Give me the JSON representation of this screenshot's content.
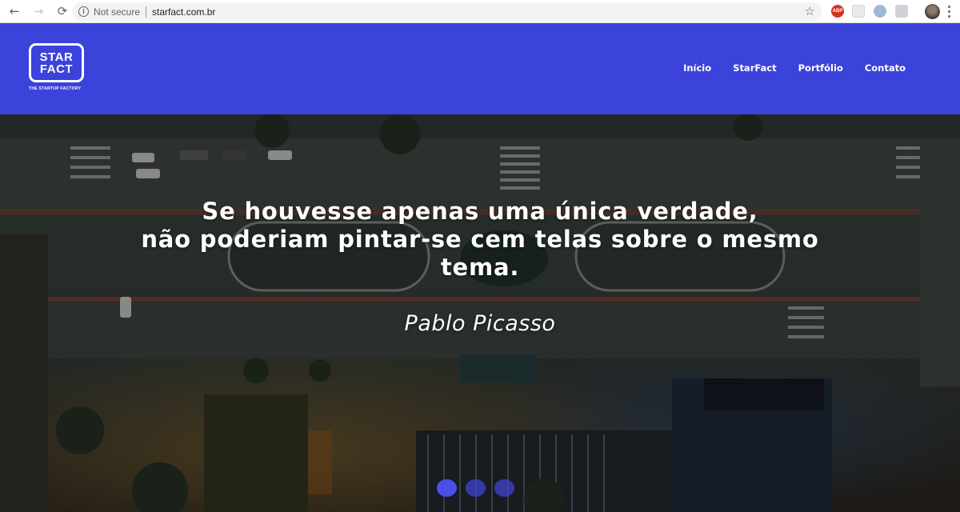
{
  "browser": {
    "back": "←",
    "forward": "→",
    "reload": "⟳",
    "security_label": "Not secure",
    "url": "starfact.com.br",
    "extension_abp": "ABP"
  },
  "logo": {
    "line1": "STAR",
    "line2": "FACT",
    "tagline": "THE STARTUP FACTORY"
  },
  "nav": {
    "items": [
      {
        "label": "Início"
      },
      {
        "label": "StarFact"
      },
      {
        "label": "Portfólio"
      },
      {
        "label": "Contato"
      }
    ]
  },
  "hero": {
    "quote_line1": "Se houvesse apenas uma única verdade,",
    "quote_line2": "não poderiam pintar-se cem telas sobre o mesmo",
    "quote_line3": "tema.",
    "author": "Pablo Picasso",
    "slides": 3,
    "active_slide": 1
  },
  "colors": {
    "header_bg": "#3b43db",
    "dot_color": "#4850e8"
  }
}
